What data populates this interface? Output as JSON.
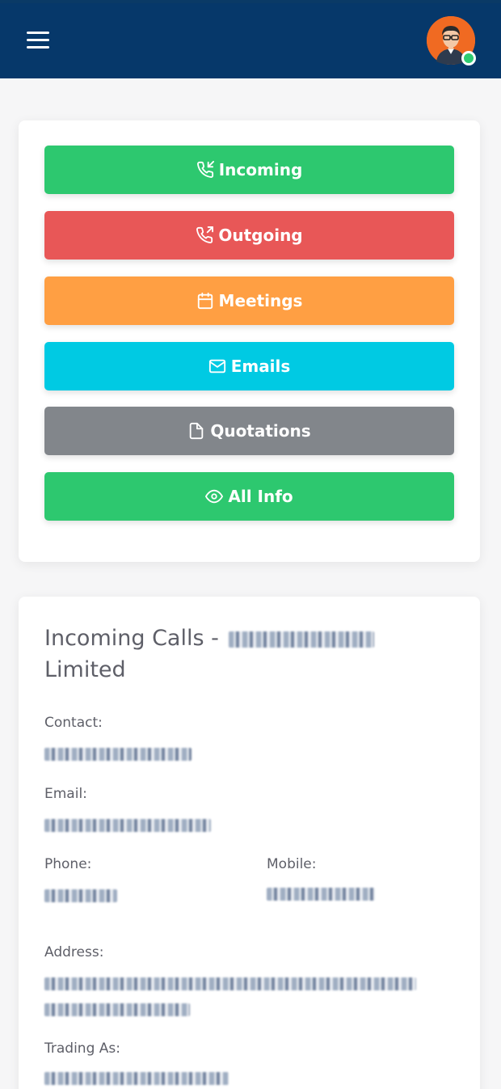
{
  "header": {
    "menu_icon": "hamburger-menu-icon",
    "avatar_icon": "user-avatar-icon",
    "status": "online",
    "colors": {
      "bar": "#06386a",
      "online": "#2ecc71"
    }
  },
  "actions": [
    {
      "label": "Incoming",
      "icon": "phone-incoming-icon",
      "color": "#2dc86f"
    },
    {
      "label": "Outgoing",
      "icon": "phone-outgoing-icon",
      "color": "#e85757"
    },
    {
      "label": "Meetings",
      "icon": "calendar-icon",
      "color": "#ff9f43"
    },
    {
      "label": "Emails",
      "icon": "mail-icon",
      "color": "#00cae3"
    },
    {
      "label": "Quotations",
      "icon": "file-icon",
      "color": "#82868b"
    },
    {
      "label": "All Info",
      "icon": "eye-icon",
      "color": "#2dc86f"
    }
  ],
  "info": {
    "title_prefix": "Incoming Calls -",
    "title_suffix": "Limited",
    "contact_label": "Contact:",
    "email_label": "Email:",
    "phone_label": "Phone:",
    "mobile_label": "Mobile:",
    "address_label": "Address:",
    "trading_label": "Trading As:"
  }
}
